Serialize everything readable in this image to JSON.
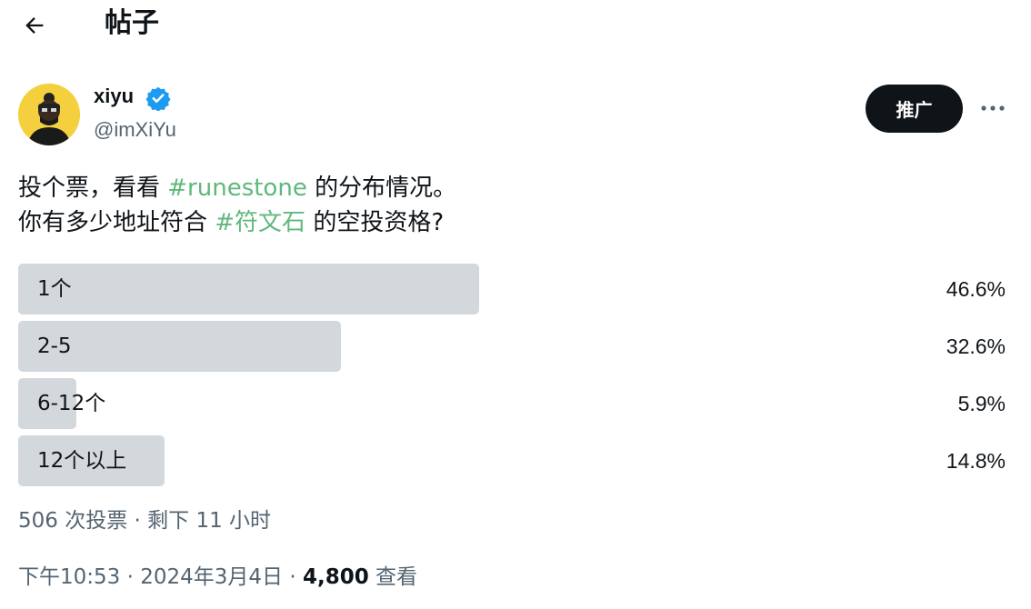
{
  "header": {
    "back_icon": "arrow-left-icon",
    "title": "帖子"
  },
  "author": {
    "name": "xiyu",
    "handle": "@imXiYu",
    "verified_icon": "verified-badge-icon",
    "verified_color": "#1d9bf0"
  },
  "actions": {
    "promote_label": "推广",
    "more_icon": "ellipsis-icon"
  },
  "tweet": {
    "line1_before": "投个票，看看 ",
    "line1_hashtag": "#runestone",
    "line1_after": " 的分布情况。",
    "line2_before": "你有多少地址符合 ",
    "line2_hashtag": "#符文石",
    "line2_after": " 的空投资格?",
    "hashtag_color": "#5fb87d"
  },
  "poll": {
    "options": [
      {
        "label": "1个",
        "percent_text": "46.6%",
        "fill": 0.466
      },
      {
        "label": "2-5",
        "percent_text": "32.6%",
        "fill": 0.326
      },
      {
        "label": "6-12个",
        "percent_text": "5.9%",
        "fill": 0.059
      },
      {
        "label": "12个以上",
        "percent_text": "14.8%",
        "fill": 0.148
      }
    ],
    "meta": "506 次投票 · 剩下 11 小时"
  },
  "post_meta": {
    "time_date": "下午10:53 · 2024年3月4日 · ",
    "views_count": "4,800",
    "views_label": " 查看"
  }
}
